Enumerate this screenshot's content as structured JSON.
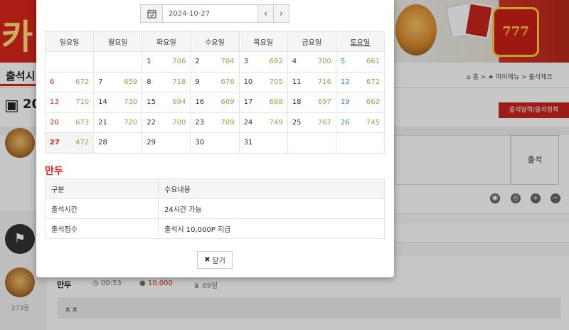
{
  "background": {
    "logo_glyph": "카",
    "slot_text": "777",
    "subnav_title": "출석시",
    "breadcrumb": "⌂ 홈 > ★ 마이메뉴 > 출석체크",
    "year_fragment": "20",
    "red_button_label": "출석달력/출석정책",
    "submit_label": "출석",
    "post": {
      "name": "만두",
      "time": "00:53",
      "points": "10,000",
      "days": "69일",
      "comment": "ㅊㅊ",
      "rank": "273등"
    }
  },
  "modal": {
    "date_value": "2024-10-27",
    "prev_label": "‹",
    "next_label": "›",
    "weekdays": [
      "일요일",
      "월요일",
      "화요일",
      "수요일",
      "목요일",
      "금요일",
      "토요일"
    ],
    "weeks": [
      [
        {
          "d": "",
          "c": ""
        },
        {
          "d": "",
          "c": ""
        },
        {
          "d": "1",
          "c": "706"
        },
        {
          "d": "2",
          "c": "704"
        },
        {
          "d": "3",
          "c": "682"
        },
        {
          "d": "4",
          "c": "700"
        },
        {
          "d": "5",
          "c": "661"
        }
      ],
      [
        {
          "d": "6",
          "c": "672"
        },
        {
          "d": "7",
          "c": "659"
        },
        {
          "d": "8",
          "c": "718"
        },
        {
          "d": "9",
          "c": "676"
        },
        {
          "d": "10",
          "c": "705"
        },
        {
          "d": "11",
          "c": "716"
        },
        {
          "d": "12",
          "c": "672"
        }
      ],
      [
        {
          "d": "13",
          "c": "710"
        },
        {
          "d": "14",
          "c": "730"
        },
        {
          "d": "15",
          "c": "694"
        },
        {
          "d": "16",
          "c": "669"
        },
        {
          "d": "17",
          "c": "688"
        },
        {
          "d": "18",
          "c": "697"
        },
        {
          "d": "19",
          "c": "662"
        }
      ],
      [
        {
          "d": "20",
          "c": "673"
        },
        {
          "d": "21",
          "c": "720"
        },
        {
          "d": "22",
          "c": "700"
        },
        {
          "d": "23",
          "c": "709"
        },
        {
          "d": "24",
          "c": "749"
        },
        {
          "d": "25",
          "c": "767"
        },
        {
          "d": "26",
          "c": "745"
        }
      ],
      [
        {
          "d": "27",
          "c": "472"
        },
        {
          "d": "28",
          "c": ""
        },
        {
          "d": "29",
          "c": ""
        },
        {
          "d": "30",
          "c": ""
        },
        {
          "d": "31",
          "c": ""
        },
        {
          "d": "",
          "c": ""
        },
        {
          "d": "",
          "c": ""
        }
      ]
    ],
    "today": "27",
    "section_title": "만두",
    "info_headers": [
      "구분",
      "수요내용"
    ],
    "info_rows": [
      [
        "출석시간",
        "24시간 가능"
      ],
      [
        "출석점수",
        "출석시 10,000P 지급"
      ]
    ],
    "close_label": "닫기",
    "colors": {
      "sunday": "#d9261c",
      "saturday": "#2a8ad4",
      "count": "#7cb342",
      "accent": "#d9261c"
    }
  }
}
